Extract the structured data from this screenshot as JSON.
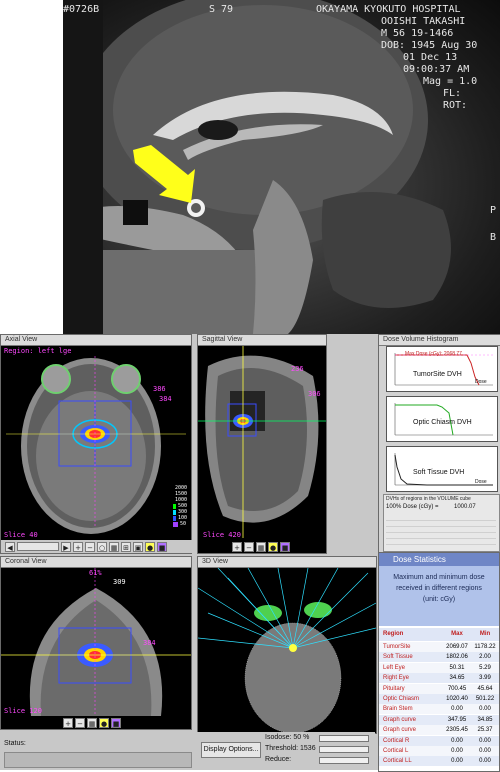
{
  "mri": {
    "top_left": "#0726B",
    "series": "S 79",
    "hospital": "OKAYAMA KYOKUTO HOSPITAL",
    "patient_name": "OOISHI TAKASHI",
    "patient_info": "M 56  19-1466",
    "dob": "DOB: 1945 Aug 30",
    "date": "01 Dec 13",
    "time": "09:00:37 AM",
    "mag": "Mag = 1.0",
    "fl": "FL:",
    "rot": "ROT:",
    "side_p": "P",
    "side_b": "B"
  },
  "axial_view": {
    "title": "Axial View",
    "region": "Region: left lge",
    "slice": "Slice 40",
    "iso_labels": [
      "2000",
      "1500",
      "1000",
      "500",
      "300",
      "100",
      "50"
    ],
    "num_a": "386",
    "num_b": "384",
    "toolbar_icons": [
      "zoom-in-icon",
      "zoom-out-icon",
      "zoom-reset-icon",
      "fit-icon",
      "grid-icon",
      "ruler-icon",
      "grid2-icon",
      "circle-icon",
      "square-icon"
    ]
  },
  "sagittal_view": {
    "title": "Sagittal View",
    "num_a": "236",
    "num_b": "306",
    "bottom_label": "Slice 420"
  },
  "coronal_view": {
    "title": "Coronal View",
    "top_label": "61%",
    "side_num": "384",
    "small_num": "309",
    "slice": "Slice 120"
  },
  "view_3d": {
    "title": "3D View",
    "display_options": "Display Options...",
    "isodose_label": "Isodose: 50 %",
    "threshold_label": "Threshold: 1536",
    "reduce_label": "Reduce:"
  },
  "dvh_panel": {
    "title": "Dose Volume Histogram",
    "charts": [
      {
        "label": "TumorSite DVH",
        "header": "Max Dose (cGy): 2068.77",
        "xlabel": "Dose"
      },
      {
        "label": "Optic Chiasm DVH",
        "header": "",
        "xlabel": ""
      },
      {
        "label": "Soft Tissue DVH",
        "header": "",
        "xlabel": "Dose"
      }
    ],
    "summary_title": "DVHs of regions in the VOLUME cube",
    "summary_dose": "100% Dose (cGy) =",
    "summary_value": "1000.07"
  },
  "dose_stats": {
    "title": "Dose Statistics",
    "subtitle": [
      "Maximum and minimum dose",
      "received in different regions",
      "(unit: cGy)"
    ],
    "headers": [
      "Region",
      "Max",
      "Min"
    ],
    "rows": [
      {
        "name": "TumorSite",
        "max": "2069.07",
        "min": "1178.22"
      },
      {
        "name": "Soft Tissue",
        "max": "1802.06",
        "min": "2.00"
      },
      {
        "name": "Left Eye",
        "max": "50.31",
        "min": "5.29"
      },
      {
        "name": "Right Eye",
        "max": "34.65",
        "min": "3.99"
      },
      {
        "name": "Pituitary",
        "max": "700.45",
        "min": "45.64"
      },
      {
        "name": "Optic Chiasm",
        "max": "1020.40",
        "min": "501.22"
      },
      {
        "name": "Brain Stem",
        "max": "0.00",
        "min": "0.00"
      },
      {
        "name": "Graph curve",
        "max": "347.95",
        "min": "34.85"
      },
      {
        "name": "Graph curve",
        "max": "2305.45",
        "min": "25.37"
      },
      {
        "name": "Cortical R",
        "max": "0.00",
        "min": "0.00"
      },
      {
        "name": "Cortical L",
        "max": "0.00",
        "min": "0.00"
      },
      {
        "name": "Cortical LL",
        "max": "0.00",
        "min": "0.00"
      }
    ]
  },
  "status": {
    "label": "Status:"
  },
  "colors": {
    "accent_overlay": "#ff49ff",
    "table_header": "#6f86c6",
    "table_band": "#b0c2ea",
    "grid_blue": "#6ea0d8"
  }
}
